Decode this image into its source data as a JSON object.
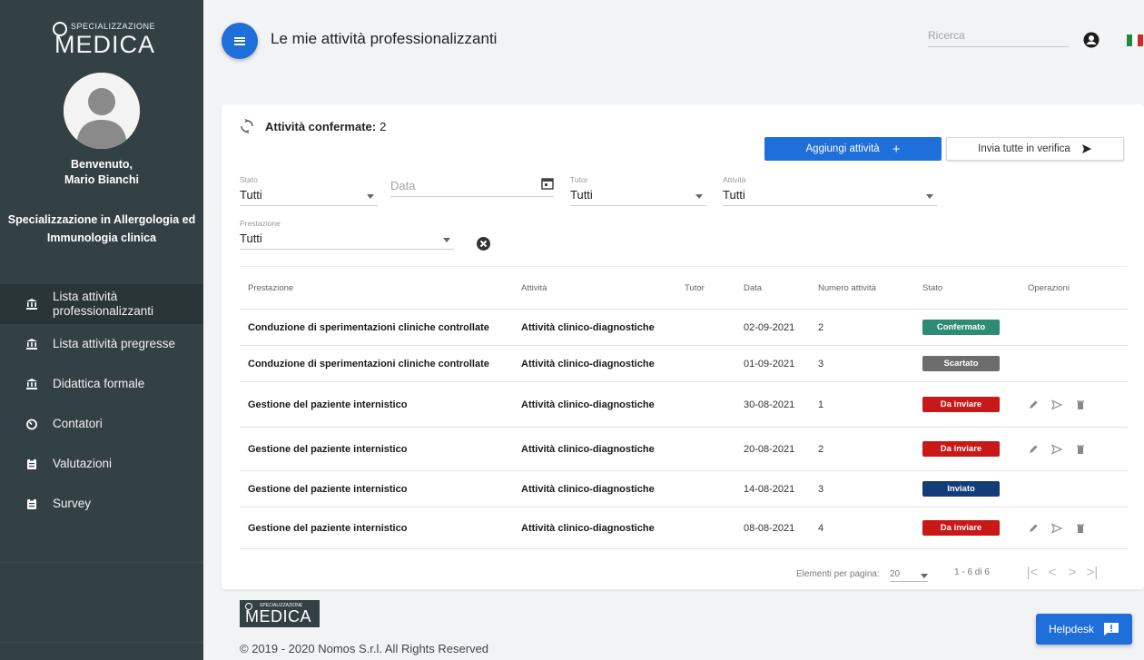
{
  "sidebar": {
    "brand_small": "SPECIALIZZAZIONE",
    "brand_big": "MEDICA",
    "welcome": "Benvenuto,",
    "user_name": "Mario Bianchi",
    "specialization_line1": "Specializzazione in Allergologia ed",
    "specialization_line2": "Immunologia clinica",
    "items": [
      {
        "label": "Lista attività professionalizzanti",
        "icon": "bank-icon",
        "active": true
      },
      {
        "label": "Lista attività pregresse",
        "icon": "bank-icon"
      },
      {
        "label": "Didattica formale",
        "icon": "bank-icon"
      },
      {
        "label": "Contatori",
        "icon": "timer-icon"
      },
      {
        "label": "Valutazioni",
        "icon": "clipboard-icon"
      },
      {
        "label": "Survey",
        "icon": "clipboard-icon"
      }
    ]
  },
  "header": {
    "title": "Le mie attività professionalizzanti",
    "search_placeholder": "Ricerca"
  },
  "card": {
    "confirmed_label": "Attività confermate:",
    "confirmed_count": "2",
    "add_button": "Aggiungi attività",
    "add_button_icon": "+",
    "send_button": "Invia tutte in verifica",
    "filters": {
      "stato": {
        "label": "Stato",
        "value": "Tutti"
      },
      "data": {
        "label": "",
        "placeholder": "Data"
      },
      "tutor": {
        "label": "Tutor",
        "value": "Tutti"
      },
      "attivita": {
        "label": "Attività",
        "value": "Tutti"
      },
      "prestazione": {
        "label": "Prestazione",
        "value": "Tutti"
      }
    }
  },
  "table": {
    "headers": [
      "Prestazione",
      "Attività",
      "Tutor",
      "Data",
      "Numero attività",
      "Stato",
      "Operazioni"
    ],
    "rows": [
      {
        "prestazione": "Conduzione di sperimentazioni cliniche controllate",
        "attivita": "Attività clinico-diagnostiche",
        "tutor": "",
        "data": "02-09-2021",
        "numero": "2",
        "stato": "Confermato",
        "stato_color": "#2e8b74",
        "ops": false
      },
      {
        "prestazione": "Conduzione di sperimentazioni cliniche controllate",
        "attivita": "Attività clinico-diagnostiche",
        "tutor": "",
        "data": "01-09-2021",
        "numero": "3",
        "stato": "Scartato",
        "stato_color": "#6d6d6d",
        "ops": false
      },
      {
        "prestazione": "Gestione del paziente internistico",
        "attivita": "Attività clinico-diagnostiche",
        "tutor": "",
        "data": "30-08-2021",
        "numero": "1",
        "stato": "Da inviare",
        "stato_color": "#c81818",
        "ops": true
      },
      {
        "prestazione": "Gestione del paziente internistico",
        "attivita": "Attività clinico-diagnostiche",
        "tutor": "",
        "data": "20-08-2021",
        "numero": "2",
        "stato": "Da inviare",
        "stato_color": "#c81818",
        "ops": true
      },
      {
        "prestazione": "Gestione del paziente internistico",
        "attivita": "Attività clinico-diagnostiche",
        "tutor": "",
        "data": "14-08-2021",
        "numero": "3",
        "stato": "Inviato",
        "stato_color": "#123c7a",
        "ops": false
      },
      {
        "prestazione": "Gestione del paziente internistico",
        "attivita": "Attività clinico-diagnostiche",
        "tutor": "",
        "data": "08-08-2021",
        "numero": "4",
        "stato": "Da inviare",
        "stato_color": "#c81818",
        "ops": true
      }
    ]
  },
  "pager": {
    "per_page_label": "Elementi per pagina:",
    "per_page_value": "20",
    "range": "1 - 6 di 6",
    "first": "|<",
    "prev": "<",
    "next": ">",
    "last": ">|"
  },
  "footer": {
    "logo_small": "SPECIALIZZAZIONE",
    "logo_big": "MEDICA",
    "copyright": "© 2019 - 2020 Nomos S.r.l. All Rights Reserved",
    "helpdesk": "Helpdesk"
  },
  "colors": {
    "sidebar_bg": "#344144",
    "primary": "#1e6fd9",
    "flag_green": "#1f8a3a",
    "flag_white": "#ffffff",
    "flag_red": "#cf2a2a"
  }
}
